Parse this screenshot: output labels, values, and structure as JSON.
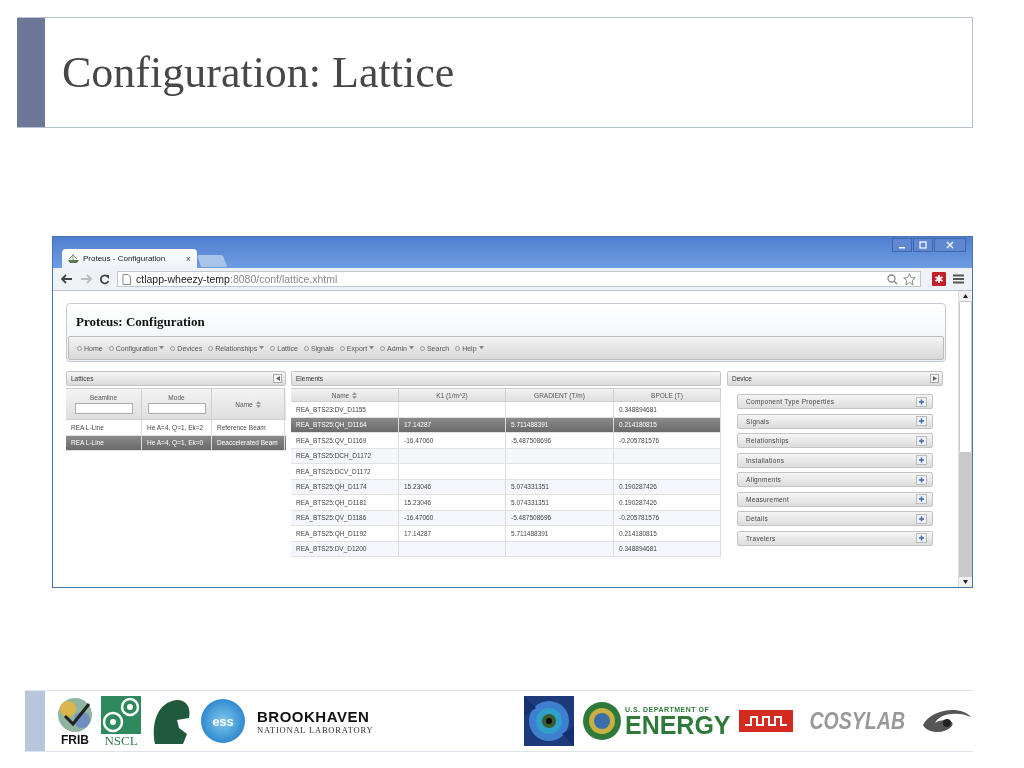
{
  "slide": {
    "title": "Configuration: Lattice"
  },
  "browser": {
    "tabs": [
      {
        "label": "Proteus - Configuration",
        "selected": true,
        "close": "×"
      }
    ],
    "address": {
      "host": "ctlapp-wheezy-temp",
      "rest": ":8080/conf/lattice.xhtml"
    }
  },
  "app": {
    "title": "Proteus: Configuration",
    "menu": [
      {
        "label": "Home",
        "dropdown": false
      },
      {
        "label": "Configuration",
        "dropdown": true
      },
      {
        "label": "Devices",
        "dropdown": false
      },
      {
        "label": "Relationships",
        "dropdown": true
      },
      {
        "label": "Lattice",
        "dropdown": false
      },
      {
        "label": "Signals",
        "dropdown": false
      },
      {
        "label": "Export",
        "dropdown": true
      },
      {
        "label": "Admin",
        "dropdown": true
      },
      {
        "label": "Search",
        "dropdown": false
      },
      {
        "label": "Help",
        "dropdown": true
      }
    ]
  },
  "lattices": {
    "title": "Lattices",
    "columns": [
      {
        "label": "Beamline",
        "filter": true,
        "sortable": false
      },
      {
        "label": "Mode",
        "filter": true,
        "sortable": false
      },
      {
        "label": "Name",
        "filter": false,
        "sortable": true
      }
    ],
    "rows": [
      {
        "cells": [
          "REA L-Line",
          "He A=4, Q=1, Ek=2",
          "Reference Beam"
        ],
        "selected": false
      },
      {
        "cells": [
          "REA L-Line",
          "He A=4, Q=1, Ek=0",
          "Deaccelerated Beam"
        ],
        "selected": true
      }
    ]
  },
  "elements": {
    "title": "Elements",
    "columns": [
      {
        "label": "Name",
        "sortable": true
      },
      {
        "label": "K1 (1/m^2)",
        "sortable": false
      },
      {
        "label": "GRADIENT (T/m)",
        "sortable": false
      },
      {
        "label": "BPOLE (T)",
        "sortable": false
      }
    ],
    "rows": [
      {
        "cells": [
          "REA_BTS23:DV_D1155",
          "",
          "",
          "0.348894681"
        ],
        "selected": false
      },
      {
        "cells": [
          "REA_BTS25:QH_D1164",
          "17.14287",
          "5.711488391",
          "0.214180815"
        ],
        "selected": true
      },
      {
        "cells": [
          "REA_BTS25:QV_D1169",
          "-16.47060",
          "-5.487508696",
          "-0.205781576"
        ],
        "selected": false
      },
      {
        "cells": [
          "REA_BTS25:DCH_D1172",
          "",
          "",
          ""
        ],
        "selected": false
      },
      {
        "cells": [
          "REA_BTS25:DCV_D1172",
          "",
          "",
          ""
        ],
        "selected": false
      },
      {
        "cells": [
          "REA_BTS25:QH_D1174",
          "15.23046",
          "5.074331351",
          "0.190287426"
        ],
        "selected": false
      },
      {
        "cells": [
          "REA_BTS25:QH_D1181",
          "15.23046",
          "5.074331351",
          "0.190287426"
        ],
        "selected": false
      },
      {
        "cells": [
          "REA_BTS25:QV_D1186",
          "-16.47060",
          "-5.487508696",
          "-0.205781576"
        ],
        "selected": false
      },
      {
        "cells": [
          "REA_BTS25:QH_D1192",
          "17.14287",
          "5.711488391",
          "0.214180815"
        ],
        "selected": false
      },
      {
        "cells": [
          "REA_BTS25:DV_D1200",
          "",
          "",
          "0.348894681"
        ],
        "selected": false
      }
    ]
  },
  "device": {
    "title": "Device",
    "sections": [
      {
        "label": "Component Type Properties",
        "expanded": false
      },
      {
        "label": "Signals",
        "expanded": false
      },
      {
        "label": "Relationships",
        "expanded": false
      },
      {
        "label": "Installations",
        "expanded": false
      },
      {
        "label": "Alignments",
        "expanded": false
      },
      {
        "label": "Measurement",
        "expanded": false
      },
      {
        "label": "Details",
        "expanded": false
      },
      {
        "label": "Travelers",
        "expanded": false
      }
    ]
  },
  "logos_left": [
    {
      "kind": "frib",
      "text": "FRIB"
    },
    {
      "kind": "nscl",
      "text": "NSCL"
    },
    {
      "kind": "helmet"
    },
    {
      "kind": "ess",
      "text": "ess"
    },
    {
      "kind": "brookhaven",
      "text": "BROOKHAVEN",
      "subtext": "NATIONAL LABORATORY"
    }
  ],
  "logos_right": [
    {
      "kind": "picture"
    },
    {
      "kind": "doe",
      "text": "U.S. DEPARTMENT OF",
      "subtext": "ENERGY"
    },
    {
      "kind": "pulse"
    },
    {
      "kind": "cosylab",
      "text": "COSYLAB"
    },
    {
      "kind": "swirl"
    }
  ]
}
